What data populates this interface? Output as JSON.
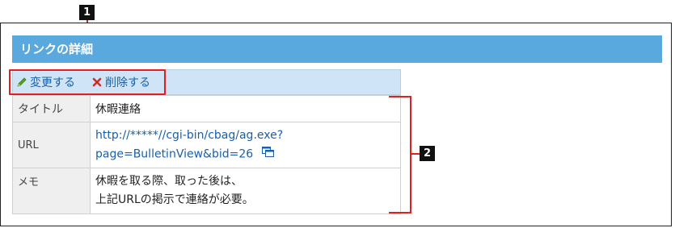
{
  "section": {
    "title": "リンクの詳細"
  },
  "toolbar": {
    "edit_label": "変更する",
    "delete_label": "削除する"
  },
  "details": {
    "title_label": "タイトル",
    "title_value": "休暇連絡",
    "url_label": "URL",
    "url_line1": "http://*****//cgi-bin/cbag/ag.exe?",
    "url_line2": "page=BulletinView&bid=26",
    "memo_label": "メモ",
    "memo_line1": "休暇を取る際、取った後は、",
    "memo_line2": "上記URLの掲示で連絡が必要。"
  },
  "callouts": {
    "marker1": "1",
    "marker2": "2"
  },
  "colors": {
    "header_bg": "#5aa9de",
    "toolbar_bg": "#cfe4f6",
    "highlight": "#e02020",
    "link": "#1a5fa8"
  },
  "icons": {
    "edit": "pencil-icon",
    "delete": "delete-x-icon",
    "external": "new-window-icon"
  }
}
